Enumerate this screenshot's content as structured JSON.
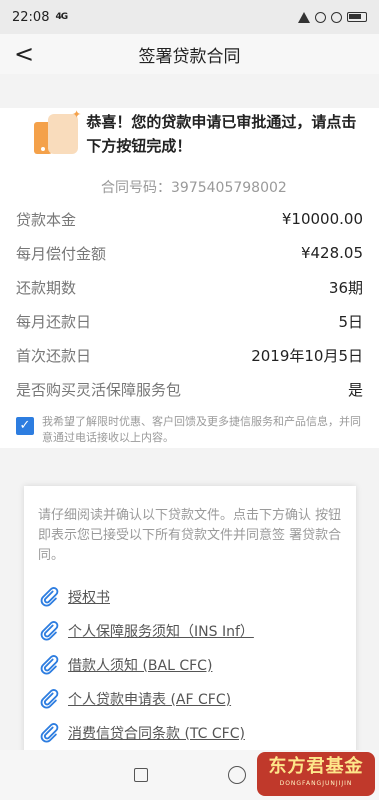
{
  "status_bar": {
    "time": "22:08",
    "signal": "4G"
  },
  "nav": {
    "title": "签署贷款合同",
    "back_glyph": "<"
  },
  "hero": {
    "message": "恭喜！您的贷款申请已审批通过，请点击下方按钮完成！"
  },
  "contract": {
    "label": "合同号码：3975405798002"
  },
  "details": [
    {
      "k": "贷款本金",
      "v": "¥10000.00"
    },
    {
      "k": "每月偿付金额",
      "v": "¥428.05"
    },
    {
      "k": "还款期数",
      "v": "36期"
    },
    {
      "k": "每月还款日",
      "v": "5日"
    },
    {
      "k": "首次还款日",
      "v": "2019年10月5日"
    },
    {
      "k": "是否购买灵活保障服务包",
      "v": "是"
    }
  ],
  "agree": {
    "checked": true,
    "text": "我希望了解限时优惠、客户回馈及更多捷信服务和产品信息，并同意通过电话接收以上内容。"
  },
  "documents": {
    "intro": "请仔细阅读并确认以下贷款文件。点击下方确认 按钮即表示您已接受以下所有贷款文件并同意签 署贷款合同。",
    "items": [
      {
        "label": "授权书"
      },
      {
        "label": "个人保障服务须知（INS Inf）"
      },
      {
        "label": "借款人须知 (BAL CFC)"
      },
      {
        "label": "个人贷款申请表 (AF CFC)"
      },
      {
        "label": "消费信贷合同条款 (TC CFC)"
      }
    ]
  },
  "watermark": {
    "main": "东方君基金",
    "sub": "DONGFANGJUNJIJIN"
  },
  "colors": {
    "accent": "#2d7de0",
    "hero_orange": "#f4a14a"
  }
}
